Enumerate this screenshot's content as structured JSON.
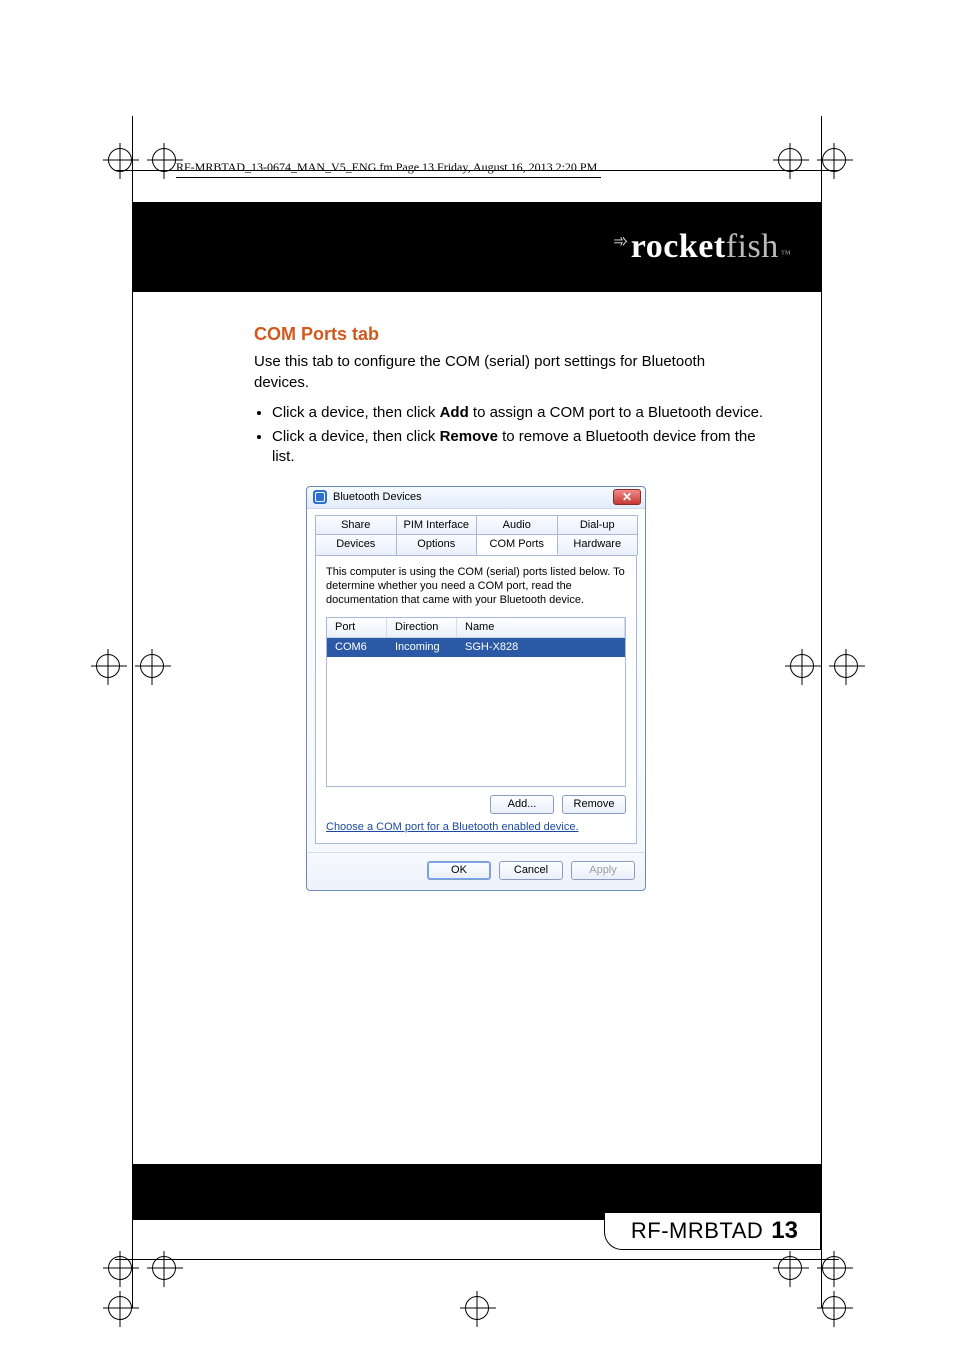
{
  "file_tag": "RF-MRBTAD_13-0674_MAN_V5_ENG.fm  Page 13  Friday, August 16, 2013  2:20 PM",
  "brand": {
    "strong": "rocket",
    "light": "fish",
    "tm": "™"
  },
  "section": {
    "heading": "COM Ports tab",
    "intro": "Use this tab to configure the COM (serial) port settings for Bluetooth devices.",
    "bullets": [
      {
        "pre": "Click a device, then click ",
        "bold": "Add",
        "post": " to assign a COM port to a Bluetooth device."
      },
      {
        "pre": "Click a device, then click ",
        "bold": "Remove",
        "post": " to remove a Bluetooth device from the list."
      }
    ]
  },
  "dialog": {
    "title": "Bluetooth Devices",
    "close_glyph": "✕",
    "tabs_row1": [
      "Share",
      "PIM Interface",
      "Audio",
      "Dial-up"
    ],
    "tabs_row2": [
      "Devices",
      "Options",
      "COM Ports",
      "Hardware"
    ],
    "active_tab": "COM Ports",
    "explain": "This computer is using the COM (serial) ports listed below. To determine whether you need a COM port, read the documentation that came with your Bluetooth device.",
    "columns": [
      "Port",
      "Direction",
      "Name"
    ],
    "rows": [
      {
        "port": "COM6",
        "direction": "Incoming",
        "name": "SGH-X828"
      }
    ],
    "add_label": "Add...",
    "remove_label": "Remove",
    "link": "Choose a COM port for a Bluetooth enabled device.",
    "ok": "OK",
    "cancel": "Cancel",
    "apply": "Apply"
  },
  "footer": {
    "model": "RF-MRBTAD",
    "page": "13"
  }
}
